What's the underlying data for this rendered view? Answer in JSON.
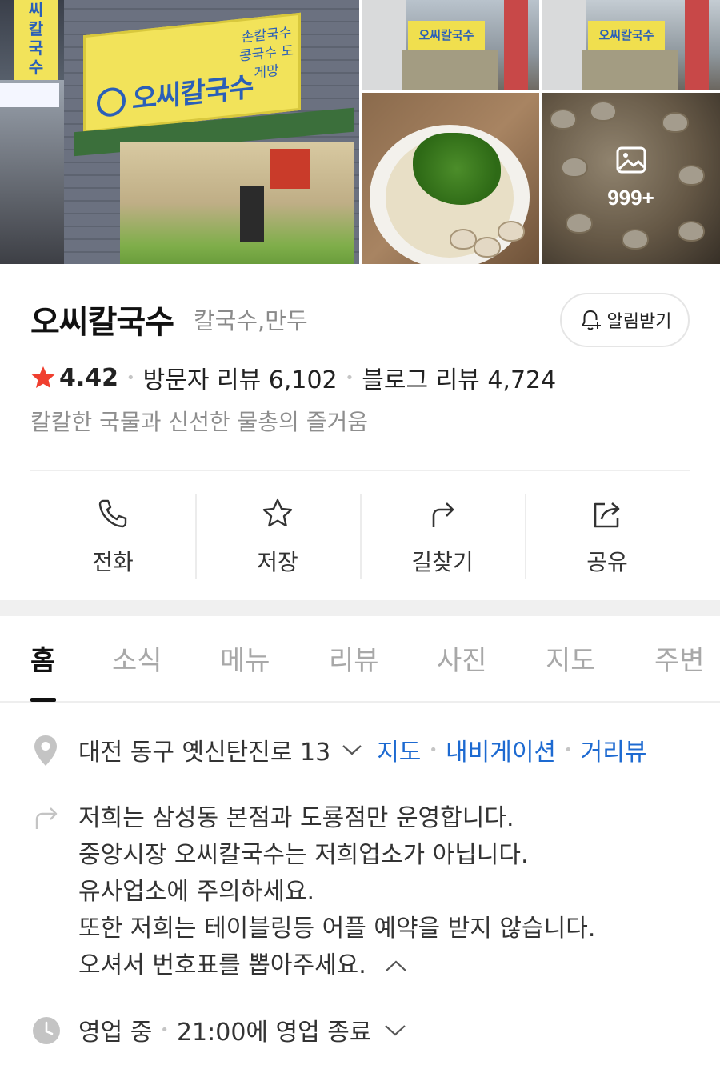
{
  "gallery": {
    "main_sign_text": "오씨칼국수",
    "main_sign_side": "손칼국수 콩국수 도게망",
    "main_vertical_sign": [
      "씨",
      "칼",
      "국",
      "수"
    ],
    "small_sign_text": "오씨칼국수",
    "more_count": "999+"
  },
  "place": {
    "name": "오씨칼국수",
    "category": "칼국수,만두",
    "notify_label": "알림받기",
    "rating": "4.42",
    "visitor_reviews": "방문자 리뷰 6,102",
    "blog_reviews": "블로그 리뷰 4,724",
    "description": "칼칼한 국물과 신선한 물총의 즐거움"
  },
  "actions": [
    {
      "label": "전화",
      "icon": "phone-icon"
    },
    {
      "label": "저장",
      "icon": "star-outline-icon"
    },
    {
      "label": "길찾기",
      "icon": "directions-icon"
    },
    {
      "label": "공유",
      "icon": "share-icon"
    }
  ],
  "tabs": [
    "홈",
    "소식",
    "메뉴",
    "리뷰",
    "사진",
    "지도",
    "주변"
  ],
  "active_tab": "홈",
  "address": {
    "text": "대전 동구 옛신탄진로 13",
    "links": [
      "지도",
      "내비게이션",
      "거리뷰"
    ]
  },
  "notice": {
    "lines": [
      "저희는 삼성동 본점과 도룡점만 운영합니다.",
      "중앙시장 오씨칼국수는 저희업소가 아닙니다.",
      "유사업소에 주의하세요.",
      "또한 저희는 테이블링등 어플 예약을 받지 않습니다.",
      "오셔서 번호표를 뽑아주세요."
    ]
  },
  "hours": {
    "status": "영업 중",
    "detail": "21:00에 영업 종료"
  },
  "colors": {
    "star": "#f03f2f",
    "link": "#1d6ad1",
    "muted": "#8e8e8e",
    "active_tab": "#111111"
  }
}
